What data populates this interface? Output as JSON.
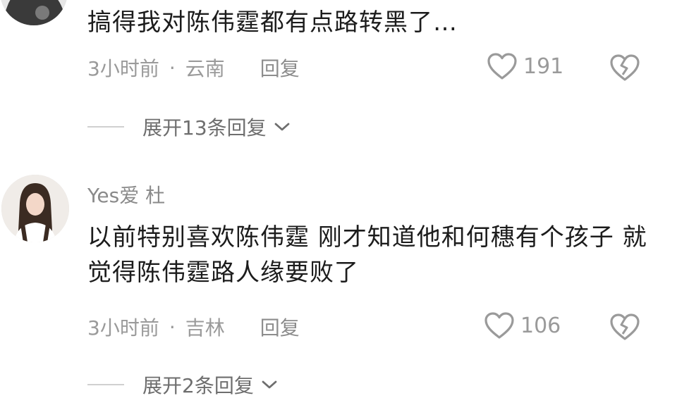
{
  "comments": [
    {
      "text": "搞得我对陈伟霆都有点路转黑了…",
      "time": "3小时前",
      "separator": "·",
      "location": "云南",
      "reply_label": "回复",
      "likes": "191",
      "expand_label": "展开13条回复"
    },
    {
      "username": "Yes爱 杜",
      "text": "以前特别喜欢陈伟霆   刚才知道他和何穗有个孩子   就觉得陈伟霆路人缘要败了",
      "time": "3小时前",
      "separator": "·",
      "location": "吉林",
      "reply_label": "回复",
      "likes": "106",
      "expand_label": "展开2条回复"
    }
  ],
  "icons": {
    "like": "heart-outline-icon",
    "dislike": "broken-heart-icon",
    "expand": "chevron-down-icon"
  },
  "colors": {
    "text": "#1c1c1c",
    "meta": "#9a9a9a",
    "expand": "#6e6e6e"
  }
}
